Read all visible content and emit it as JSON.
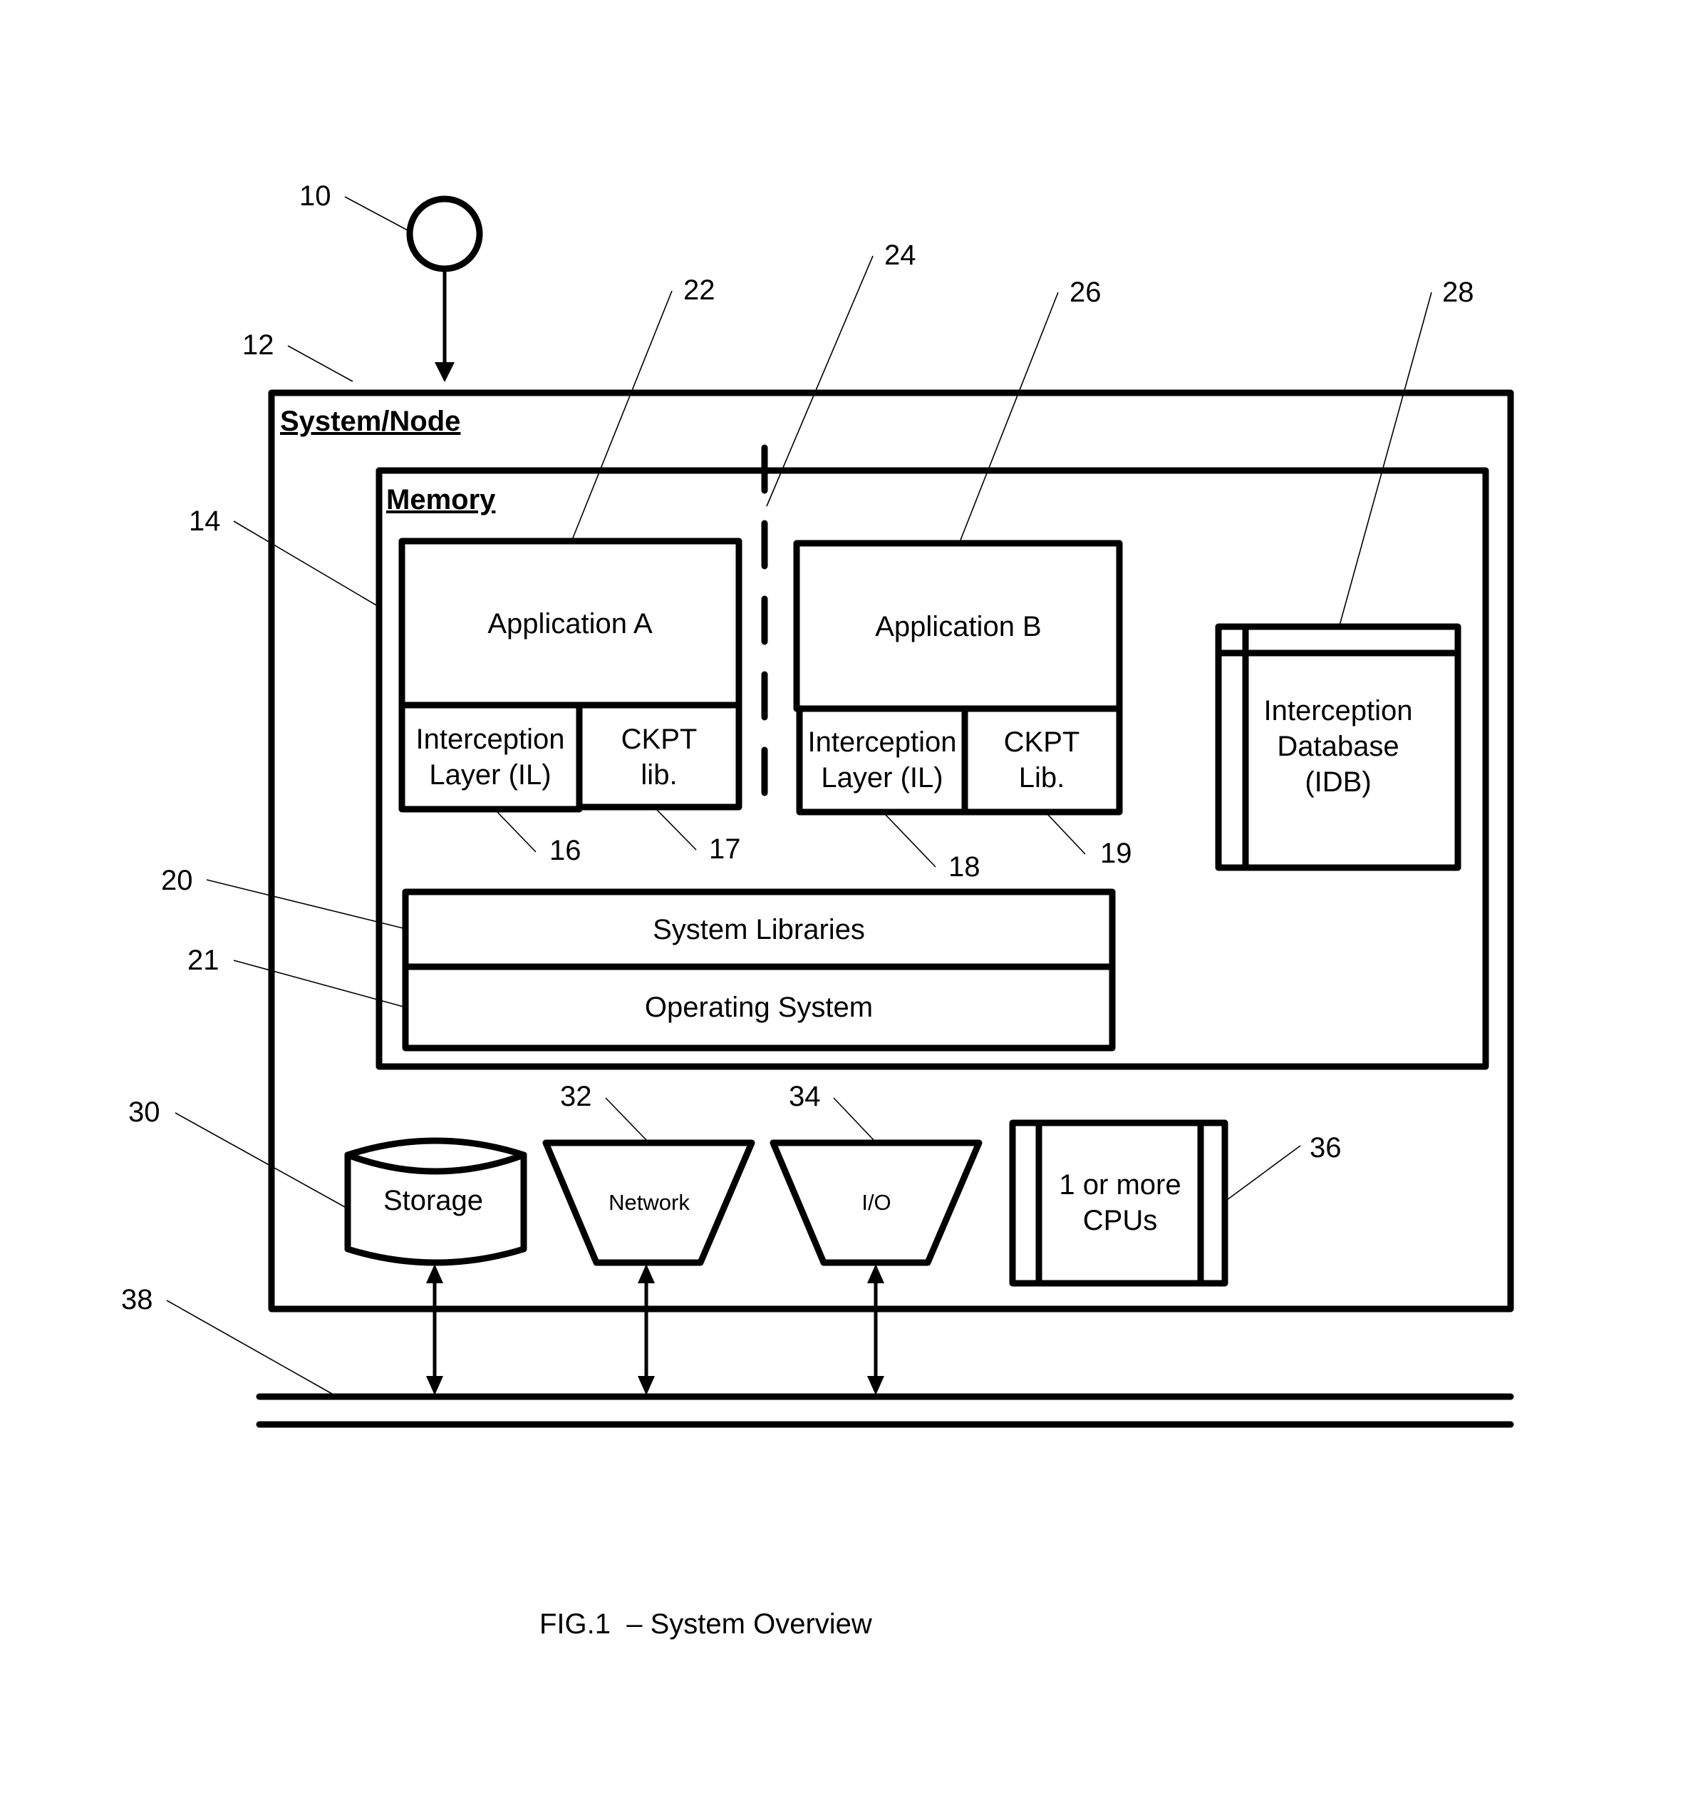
{
  "figure": {
    "caption": "FIG.1  – System Overview"
  },
  "system": {
    "title": "System/Node",
    "ref": "12"
  },
  "actor": {
    "ref": "10"
  },
  "memory": {
    "title": "Memory",
    "ref": "14"
  },
  "app_a": {
    "label": "Application A",
    "ref": "22",
    "il_line1": "Interception",
    "il_line2": "Layer (IL)",
    "il_ref": "16",
    "ckpt_line1": "CKPT",
    "ckpt_line2": "lib.",
    "ckpt_ref": "17"
  },
  "separator": {
    "ref": "24"
  },
  "app_b": {
    "label": "Application B",
    "ref": "26",
    "il_line1": "Interception",
    "il_line2": "Layer (IL)",
    "il_ref": "18",
    "ckpt_line1": "CKPT",
    "ckpt_line2": "Lib.",
    "ckpt_ref": "19"
  },
  "idb": {
    "line1": "Interception",
    "line2": "Database",
    "line3": "(IDB)",
    "ref": "28"
  },
  "system_libraries": {
    "label": "System Libraries",
    "ref": "20"
  },
  "operating_system": {
    "label": "Operating System",
    "ref": "21"
  },
  "storage": {
    "label": "Storage",
    "ref": "30"
  },
  "network": {
    "label": "Network",
    "ref": "32"
  },
  "io": {
    "label": "I/O",
    "ref": "34"
  },
  "cpus": {
    "line1": "1 or more",
    "line2": "CPUs",
    "ref": "36"
  },
  "bus": {
    "ref": "38"
  }
}
